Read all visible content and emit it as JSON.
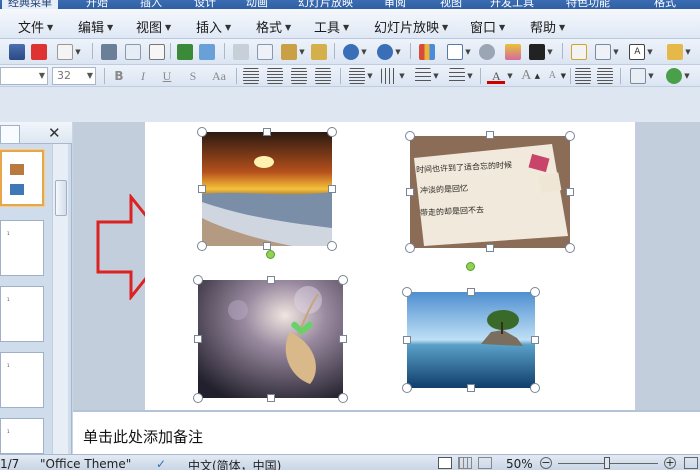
{
  "ribbon_tabs": [
    "经典菜单",
    "开始",
    "插入",
    "设计",
    "动画",
    "幻灯片放映",
    "审阅",
    "视图",
    "开发工具",
    "特色功能",
    "格式"
  ],
  "menu": [
    {
      "label": "文件"
    },
    {
      "label": "编辑"
    },
    {
      "label": "视图"
    },
    {
      "label": "插入"
    },
    {
      "label": "格式"
    },
    {
      "label": "工具"
    },
    {
      "label": "幻灯片放映"
    },
    {
      "label": "窗口"
    },
    {
      "label": "帮助"
    }
  ],
  "toolbar": {
    "font_name": "",
    "font_size": "32",
    "bold": "B",
    "italic": "I",
    "underline": "U",
    "strikethrough": "S",
    "change_case": "Aa",
    "font_color_label": "A",
    "grow_font": "A",
    "shrink_font": "A"
  },
  "slides_pane": {
    "thumbnails": [
      {
        "selected": true,
        "label": ""
      },
      {
        "selected": false,
        "label": "1"
      },
      {
        "selected": false,
        "label": "1"
      },
      {
        "selected": false,
        "label": "1"
      },
      {
        "selected": false,
        "label": "1"
      }
    ]
  },
  "slide": {
    "pictures": [
      {
        "name": "sunset-beach-photo",
        "colors": [
          "#2a1a12",
          "#d97a1e",
          "#f7c23a",
          "#6a4a3a",
          "#cfd6e0",
          "#8fa3b8"
        ]
      },
      {
        "name": "handwritten-note-photo",
        "colors": [
          "#8b6d57",
          "#e6dccb",
          "#f5efe4",
          "#3a2a22"
        ],
        "note_lines": [
          "时间也许到了适合忘的时候",
          "冲淡的是回忆",
          "带走的却是回不去"
        ]
      },
      {
        "name": "dry-leaf-heart-photo",
        "colors": [
          "#2c2a35",
          "#6a6070",
          "#d9c3a0",
          "#6ad06a",
          "#f0e6e0"
        ]
      },
      {
        "name": "island-tree-photo",
        "colors": [
          "#4f8fd0",
          "#bfe0f5",
          "#2c6e9e",
          "#0f3e6a",
          "#3a6a2a"
        ]
      }
    ],
    "arrow_color": "#dd2222"
  },
  "notes": {
    "placeholder": "单击此处添加备注"
  },
  "status": {
    "slide_counter": "1/7",
    "theme": "\"Office Theme\"",
    "language": "中文(简体，中国)",
    "zoom": "50%"
  }
}
